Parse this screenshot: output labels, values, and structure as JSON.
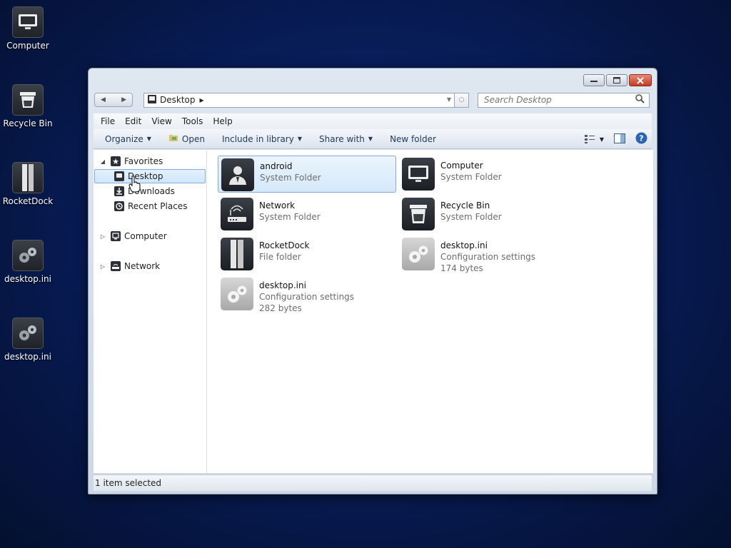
{
  "desktop": {
    "icons": [
      {
        "label": "Computer",
        "icon": "monitor-icon"
      },
      {
        "label": "Recycle Bin",
        "icon": "recycle-bin-icon"
      },
      {
        "label": "RocketDock",
        "icon": "rocketdock-icon"
      },
      {
        "label": "desktop.ini",
        "icon": "gears-icon"
      },
      {
        "label": "desktop.ini",
        "icon": "gears-icon"
      }
    ]
  },
  "window": {
    "address": {
      "location": "Desktop"
    },
    "search": {
      "placeholder": "Search Desktop"
    },
    "menu": [
      "File",
      "Edit",
      "View",
      "Tools",
      "Help"
    ],
    "commands": {
      "organize": "Organize",
      "open": "Open",
      "include": "Include in library",
      "share": "Share with",
      "new_folder": "New folder"
    },
    "nav": {
      "favorites": "Favorites",
      "desktop": "Desktop",
      "downloads": "Downloads",
      "recent": "Recent Places",
      "computer": "Computer",
      "network": "Network"
    },
    "files": [
      {
        "name": "android",
        "type": "System Folder",
        "size": "",
        "icon": "user-icon",
        "selected": true
      },
      {
        "name": "Computer",
        "type": "System Folder",
        "size": "",
        "icon": "monitor-icon"
      },
      {
        "name": "Network",
        "type": "System Folder",
        "size": "",
        "icon": "router-icon"
      },
      {
        "name": "Recycle Bin",
        "type": "System Folder",
        "size": "",
        "icon": "recycle-bin-icon"
      },
      {
        "name": "RocketDock",
        "type": "File folder",
        "size": "",
        "icon": "rocketdock-icon"
      },
      {
        "name": "desktop.ini",
        "type": "Configuration settings",
        "size": "174 bytes",
        "icon": "gears-icon"
      },
      {
        "name": "desktop.ini",
        "type": "Configuration settings",
        "size": "282 bytes",
        "icon": "gears-icon"
      }
    ],
    "status": "1 item selected",
    "colors": {
      "accent": "#84acdd",
      "desktop_bg": "#081d5a"
    }
  }
}
